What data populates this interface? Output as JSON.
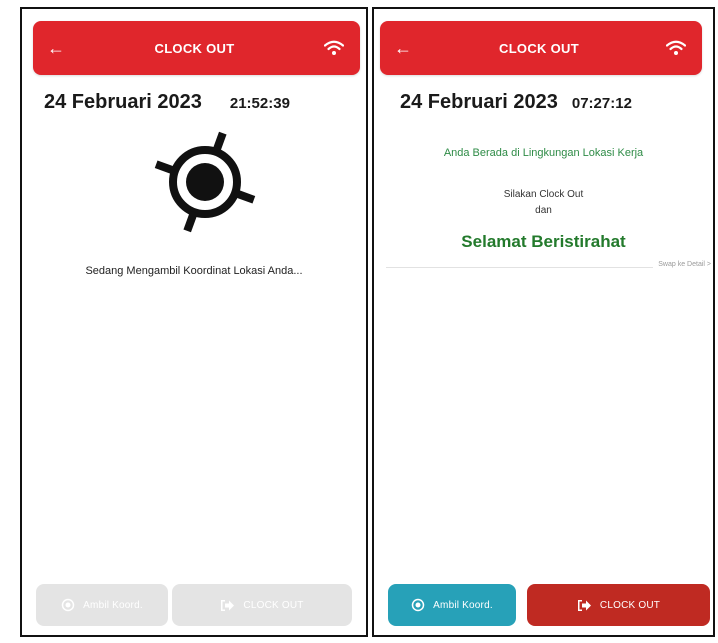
{
  "left_screen": {
    "header": {
      "title": "CLOCK OUT",
      "back_icon": "arrow-left-icon",
      "status_icon": "wifi-icon"
    },
    "date": "24 Februari 2023",
    "time": "21:52:39",
    "location_icon": "gps-locate-icon",
    "status_message": "Sedang Mengambil Koordinat Lokasi Anda...",
    "buttons": {
      "coordinate": {
        "label": "Ambil Koord.",
        "icon": "locate-icon",
        "state": "disabled"
      },
      "clock_out": {
        "label": "CLOCK OUT",
        "icon": "sign-out-icon",
        "state": "disabled"
      }
    }
  },
  "right_screen": {
    "header": {
      "title": "CLOCK OUT",
      "back_icon": "arrow-left-icon",
      "status_icon": "wifi-icon"
    },
    "date": "24 Februari 2023",
    "time": "07:27:12",
    "location_status": "Anda Berada di Lingkungan Lokasi Kerja",
    "instruction_line1": "Silakan Clock Out",
    "instruction_line2": "dan",
    "greeting": "Selamat Beristirahat",
    "swipe_hint": "Swap ke Detail >",
    "buttons": {
      "coordinate": {
        "label": "Ambil Koord.",
        "icon": "locate-icon",
        "state": "enabled"
      },
      "clock_out": {
        "label": "CLOCK OUT",
        "icon": "sign-out-icon",
        "state": "enabled"
      }
    }
  },
  "colors": {
    "header_red": "#e0262c",
    "status_green": "#2e8b46",
    "greeting_green": "#237a2c",
    "coord_button_teal": "#27a1b8",
    "clockout_button_red": "#bf2a22",
    "disabled_grey": "#e4e4e4"
  }
}
